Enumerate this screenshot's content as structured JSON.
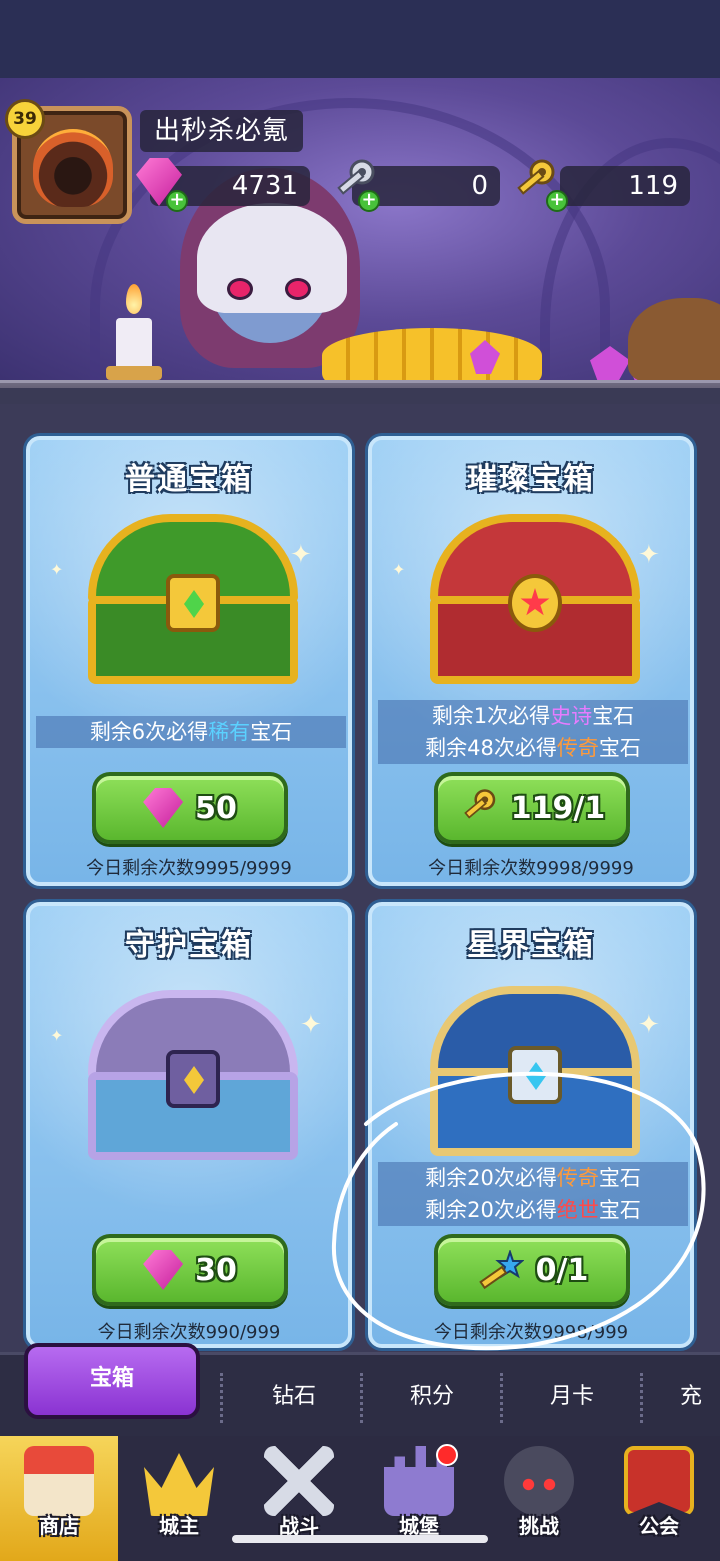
{
  "player": {
    "level": "39",
    "name": "出秒杀必氪",
    "resources": {
      "gems": "4731",
      "silver_keys": "0",
      "gold_keys": "119"
    }
  },
  "chests": [
    {
      "title": "普通宝箱",
      "info_lines": [
        {
          "prefix": "剩余6次必得",
          "highlight": "稀有",
          "suffix": "宝石",
          "highlight_color": "#5bd1ff"
        }
      ],
      "cost_icon": "gem-icon",
      "cost": "50",
      "remaining": "今日剩余次数9995/9999"
    },
    {
      "title": "璀璨宝箱",
      "info_lines": [
        {
          "prefix": "剩余1次必得",
          "highlight": "史诗",
          "suffix": "宝石",
          "highlight_color": "#e67cff"
        },
        {
          "prefix": "剩余48次必得",
          "highlight": "传奇",
          "suffix": "宝石",
          "highlight_color": "#ff9a3a"
        }
      ],
      "cost_icon": "gold-key-icon",
      "cost": "119/1",
      "remaining": "今日剩余次数9998/9999"
    },
    {
      "title": "守护宝箱",
      "info_lines": [],
      "cost_icon": "gem-icon",
      "cost": "30",
      "remaining": "今日剩余次数990/999"
    },
    {
      "title": "星界宝箱",
      "info_lines": [
        {
          "prefix": "剩余20次必得",
          "highlight": "传奇",
          "suffix": "宝石",
          "highlight_color": "#ff9a3a"
        },
        {
          "prefix": "剩余20次必得",
          "highlight": "绝世",
          "suffix": "宝石",
          "highlight_color": "#ff4a4a"
        }
      ],
      "cost_icon": "star-key-icon",
      "cost": "0/1",
      "remaining": "今日剩余次数9998/999"
    }
  ],
  "subtabs": [
    "宝箱",
    "钻石",
    "积分",
    "月卡",
    "充"
  ],
  "bottom_nav": [
    {
      "label": "商店",
      "icon": "shop-icon",
      "active": true
    },
    {
      "label": "城主",
      "icon": "crown-icon",
      "active": false
    },
    {
      "label": "战斗",
      "icon": "crossed-swords-icon",
      "active": false
    },
    {
      "label": "城堡",
      "icon": "castle-icon",
      "active": false
    },
    {
      "label": "挑战",
      "icon": "demon-mask-icon",
      "active": false
    },
    {
      "label": "公会",
      "icon": "guild-banner-icon",
      "active": false
    }
  ],
  "colors": {
    "card_blue": "#78b5e8",
    "button_green": "#5ab72e",
    "active_tab_purple": "#8a33d2",
    "active_nav_gold": "#e2a81a",
    "annotation_white": "#ffffff"
  }
}
